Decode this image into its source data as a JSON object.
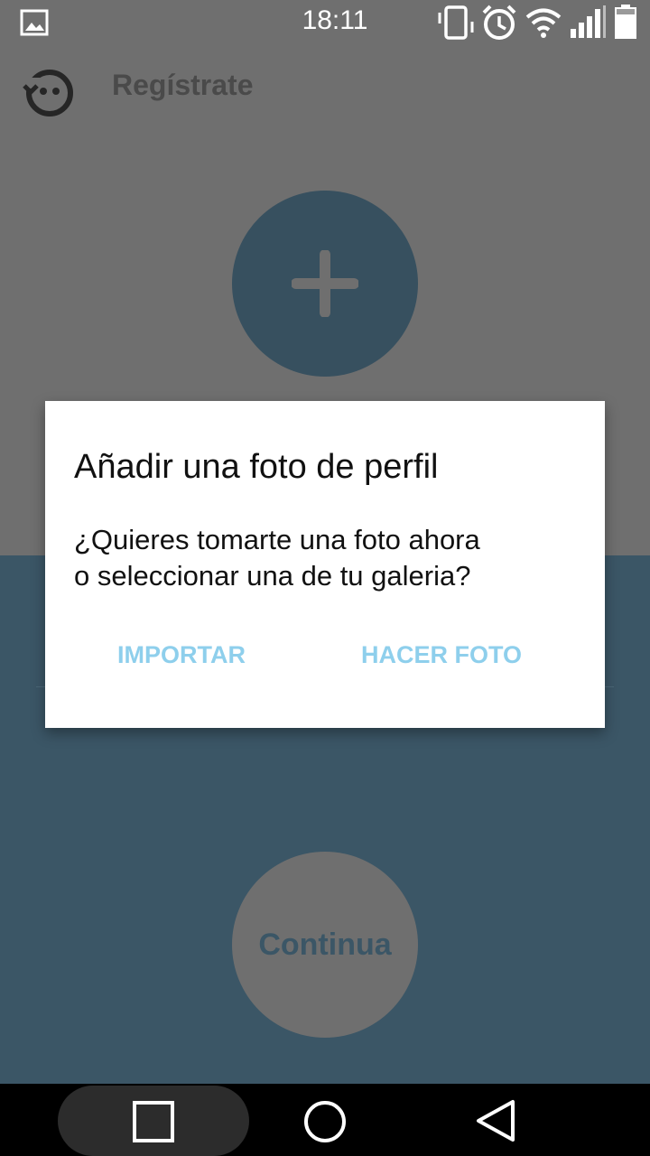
{
  "status_bar": {
    "time": "18:11",
    "icons": [
      "image-notification-icon",
      "vibrate-icon",
      "alarm-icon",
      "wifi-icon",
      "signal-icon",
      "battery-icon"
    ]
  },
  "app_bar": {
    "title": "Regístrate",
    "back_icon": "back-face-icon"
  },
  "content": {
    "add_photo_icon": "plus-icon",
    "continue_label": "Continua"
  },
  "dialog": {
    "title": "Añadir una foto de perfil",
    "body_line1": "¿Quieres tomarte una foto ahora",
    "body_line2": "o seleccionar una de tu galeria?",
    "import_label": "IMPORTAR",
    "take_photo_label": "HACER FOTO"
  },
  "nav_bar": {
    "buttons": [
      "recents-square-icon",
      "home-circle-icon",
      "back-triangle-icon"
    ]
  },
  "colors": {
    "overlay_gray": "#6f6f6f",
    "primary_dark": "#3b5666",
    "dialog_button": "#8ecfec"
  }
}
